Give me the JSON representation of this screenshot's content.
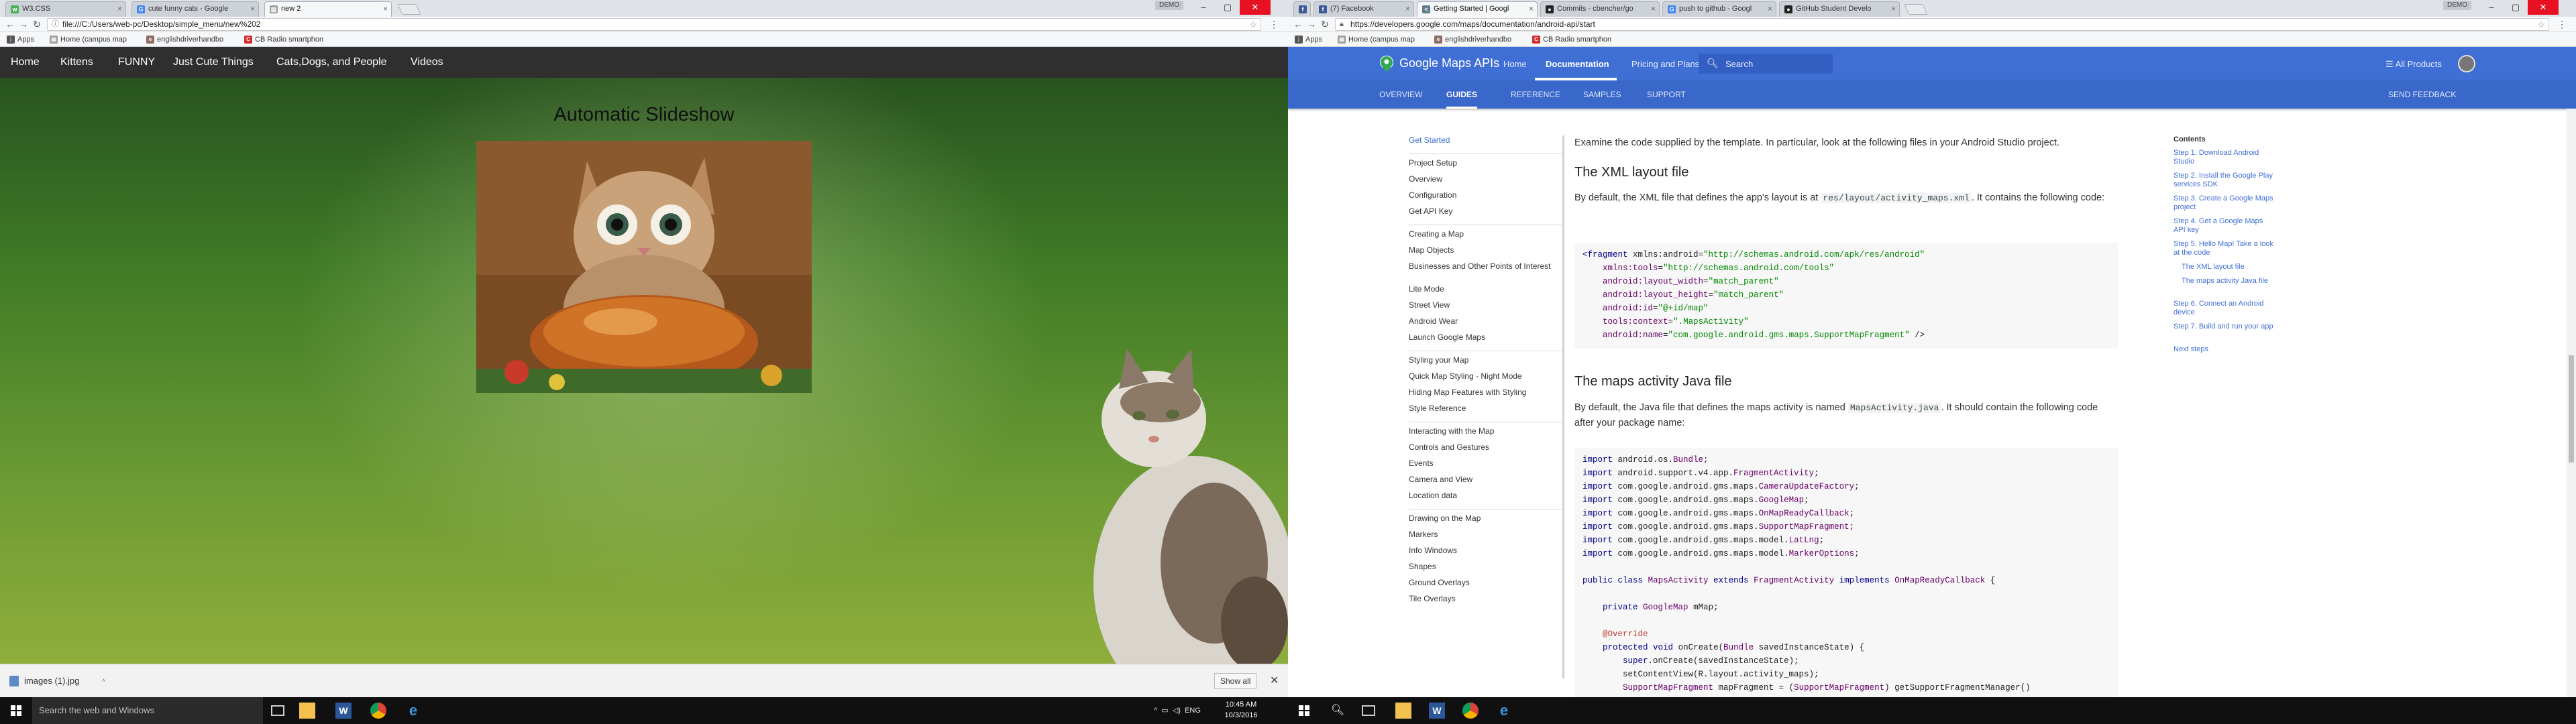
{
  "left": {
    "tabs": [
      {
        "title": "W3.CSS",
        "favicon": "w3-icon",
        "active": false
      },
      {
        "title": "cute funny cats - Google",
        "favicon": "google-icon",
        "active": false
      },
      {
        "title": "new 2",
        "favicon": "page-icon",
        "active": true
      }
    ],
    "profile_label": "DEMO",
    "url": "file:///C:/Users/web-pc/Desktop/simple_menu/new%202",
    "bookmarks": [
      {
        "label": "Apps",
        "icon": "apps-icon"
      },
      {
        "label": "Home (campus map",
        "icon": "page-icon"
      },
      {
        "label": "englishdriverhandbo",
        "icon": "book-icon"
      },
      {
        "label": "CB Radio smartphon",
        "icon": "radio-icon"
      }
    ],
    "page": {
      "nav": [
        "Home",
        "Kittens",
        "FUNNY",
        "Just Cute Things",
        "Cats,Dogs, and People",
        "Videos"
      ],
      "title": "Automatic Slideshow"
    },
    "download": {
      "file": "images (1).jpg",
      "show_all": "Show all"
    }
  },
  "right": {
    "tabs": [
      {
        "title": "",
        "favicon": "facebook-icon",
        "active": false
      },
      {
        "title": "(7) Facebook",
        "favicon": "facebook-icon",
        "active": false
      },
      {
        "title": "Getting Started | Googl",
        "favicon": "code-icon",
        "active": true
      },
      {
        "title": "Commits - cbencher/go",
        "favicon": "github-icon",
        "active": false
      },
      {
        "title": "push to github - Googl",
        "favicon": "google-icon",
        "active": false
      },
      {
        "title": "GitHub Student Develo",
        "favicon": "github-icon",
        "active": false
      }
    ],
    "profile_label": "DEMO",
    "url": "https://developers.google.com/maps/documentation/android-api/start",
    "bookmarks": [
      {
        "label": "Apps",
        "icon": "apps-icon"
      },
      {
        "label": "Home (campus map",
        "icon": "page-icon"
      },
      {
        "label": "englishdriverhandbo",
        "icon": "book-icon"
      },
      {
        "label": "CB Radio smartphon",
        "icon": "radio-icon"
      }
    ],
    "header": {
      "brand": "Google Maps APIs",
      "links": [
        "Home",
        "Documentation",
        "Pricing and Plans"
      ],
      "active_link": "Documentation",
      "search_placeholder": "Search",
      "all_products": "All Products",
      "subnav": [
        "OVERVIEW",
        "GUIDES",
        "REFERENCE",
        "SAMPLES",
        "SUPPORT"
      ],
      "active_subnav": "GUIDES",
      "feedback": "SEND FEEDBACK"
    },
    "left_nav": {
      "active": "Get Started",
      "groups": [
        [
          "Get Started"
        ],
        [
          "Project Setup",
          "Overview",
          "Configuration",
          "Get API Key"
        ],
        [
          "Creating a Map",
          "Map Objects",
          "Businesses and Other Points of Interest",
          "Lite Mode",
          "Street View",
          "Android Wear",
          "Launch Google Maps"
        ],
        [
          "Styling your Map",
          "Quick Map Styling - Night Mode",
          "Hiding Map Features with Styling",
          "Style Reference"
        ],
        [
          "Interacting with the Map",
          "Controls and Gestures",
          "Events",
          "Camera and View",
          "Location data"
        ],
        [
          "Drawing on the Map",
          "Markers",
          "Info Windows",
          "Shapes",
          "Ground Overlays",
          "Tile Overlays"
        ]
      ]
    },
    "content": {
      "intro": "Examine the code supplied by the template. In particular, look at the following files in your Android Studio project.",
      "h_xml": "The XML layout file",
      "xml_para_pre": "By default, the XML file that defines the app's layout is at",
      "xml_path": "res/layout/activity_maps.xml",
      "xml_para_post": ". It contains the following code:",
      "xml_code": [
        "<fragment xmlns:android=\"http://schemas.android.com/apk/res/android\"",
        "    xmlns:tools=\"http://schemas.android.com/tools\"",
        "    android:layout_width=\"match_parent\"",
        "    android:layout_height=\"match_parent\"",
        "    android:id=\"@+id/map\"",
        "    tools:context=\".MapsActivity\"",
        "    android:name=\"com.google.android.gms.maps.SupportMapFragment\" />"
      ],
      "h_java": "The maps activity Java file",
      "java_para_pre": "By default, the Java file that defines the maps activity is named",
      "java_file": "MapsActivity.java",
      "java_para_post": ". It should contain the following code after your package name:",
      "java_code": [
        "import android.os.Bundle;",
        "import android.support.v4.app.FragmentActivity;",
        "import com.google.android.gms.maps.CameraUpdateFactory;",
        "import com.google.android.gms.maps.GoogleMap;",
        "import com.google.android.gms.maps.OnMapReadyCallback;",
        "import com.google.android.gms.maps.SupportMapFragment;",
        "import com.google.android.gms.maps.model.LatLng;",
        "import com.google.android.gms.maps.model.MarkerOptions;",
        "",
        "public class MapsActivity extends FragmentActivity implements OnMapReadyCallback {",
        "",
        "    private GoogleMap mMap;",
        "",
        "    @Override",
        "    protected void onCreate(Bundle savedInstanceState) {",
        "        super.onCreate(savedInstanceState);",
        "        setContentView(R.layout.activity_maps);",
        "        SupportMapFragment mapFragment = (SupportMapFragment) getSupportFragmentManager()"
      ]
    },
    "toc": {
      "title": "Contents",
      "items": [
        {
          "label": "Step 1. Download Android Studio",
          "sub": false
        },
        {
          "label": "Step 2. Install the Google Play services SDK",
          "sub": false
        },
        {
          "label": "Step 3. Create a Google Maps project",
          "sub": false
        },
        {
          "label": "Step 4. Get a Google Maps API key",
          "sub": false
        },
        {
          "label": "Step 5. Hello Map! Take a look at the code",
          "sub": false
        },
        {
          "label": "The XML layout file",
          "sub": true
        },
        {
          "label": "The maps activity Java file",
          "sub": true
        },
        {
          "label": "Step 6. Connect an Android device",
          "sub": false
        },
        {
          "label": "Step 7. Build and run your app",
          "sub": false
        },
        {
          "label": "Next steps",
          "sub": false
        }
      ]
    }
  },
  "taskbar": {
    "search_placeholder": "Search the web and Windows",
    "language": "ENG",
    "time": "10:45 AM",
    "date": "10/3/2016"
  },
  "colors": {
    "maps_blue": "#3f6fd5",
    "nav_dark": "#2f2f2f",
    "code_keyword": "#008",
    "code_type": "#660066",
    "code_string": "#080"
  }
}
